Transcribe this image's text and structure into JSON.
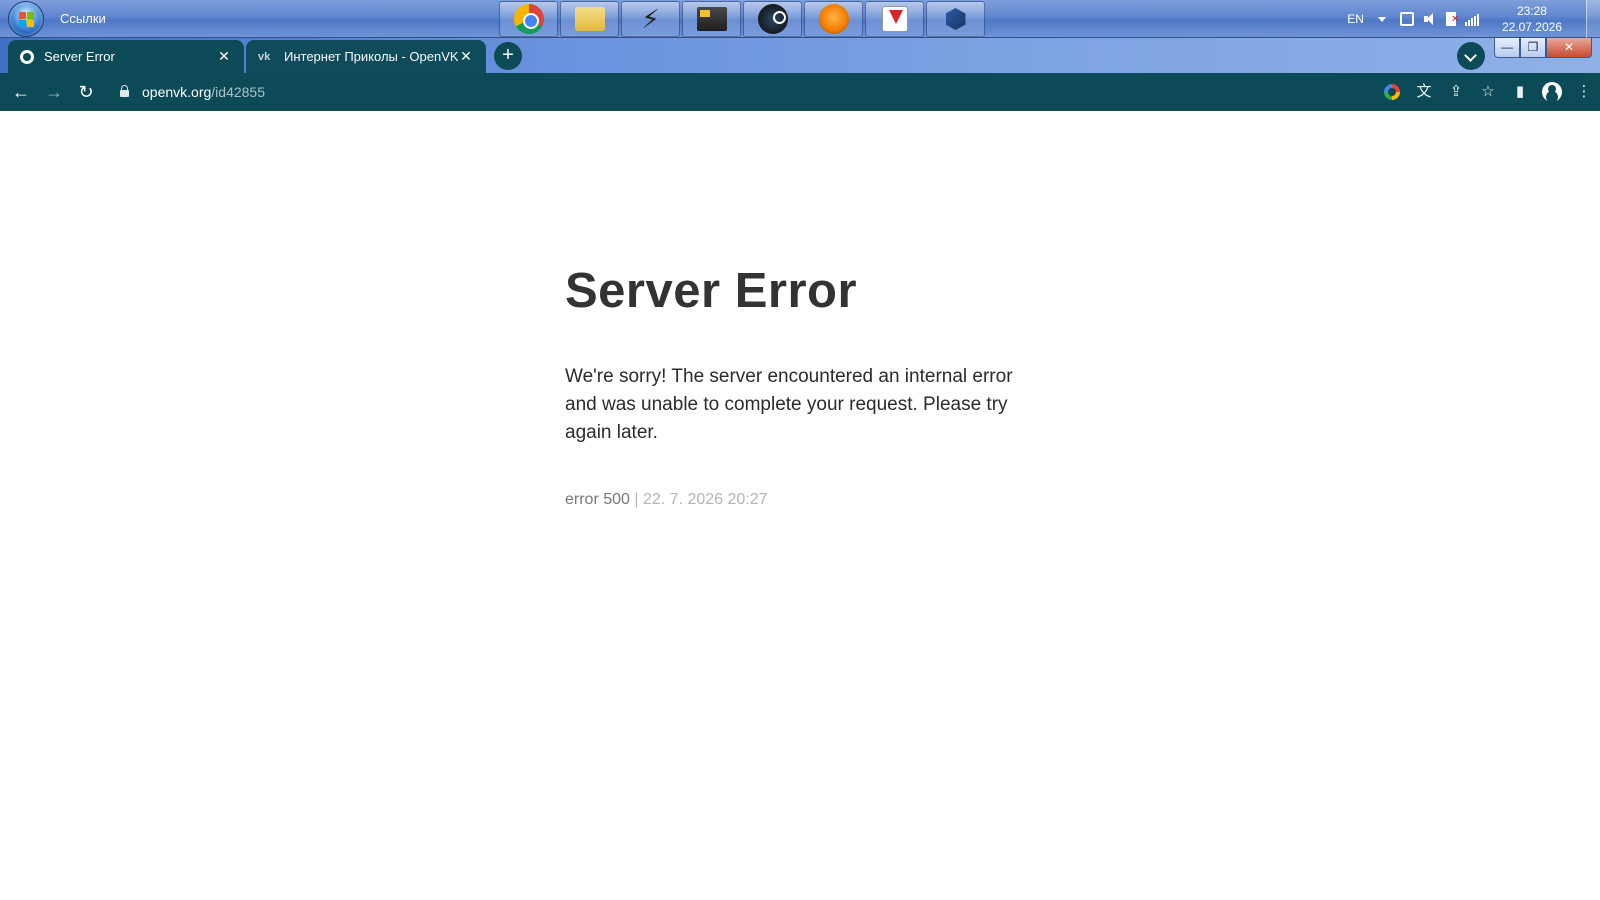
{
  "taskbar": {
    "links_label": "Ссылки",
    "pinned": [
      "chrome-icon",
      "folder-icon",
      "winamp-icon",
      "monitor-icon",
      "steam-icon",
      "fl-studio-icon",
      "download-icon",
      "virtualbox-icon"
    ],
    "tray": {
      "language": "EN",
      "time": "23:28",
      "date": "22.07.2026"
    }
  },
  "browser": {
    "tabs": [
      {
        "title": "Server Error",
        "close": "✕",
        "active": true
      },
      {
        "title": "Интернет Приколы - OpenVK",
        "close": "✕",
        "active": false
      }
    ],
    "new_tab_label": "+",
    "window_controls": {
      "minimize": "—",
      "maximize": "❐",
      "close": "✕"
    },
    "address": {
      "host": "openvk.org",
      "path": "/id42855"
    },
    "nav": {
      "back": "←",
      "forward": "→",
      "reload": "↻"
    },
    "toolbar_icons": {
      "share": "⇪",
      "bookmark": "☆",
      "sidepanel": "▮",
      "menu": "⋮",
      "translate": "文"
    }
  },
  "page": {
    "title": "Server Error",
    "message": "We're sorry! The server encountered an internal error and was unable to complete your request. Please try again later.",
    "error_code": "error 500",
    "separator": "|",
    "timestamp": "22. 7. 2026 20:27"
  },
  "colors": {
    "toolbar": "#0d4a57",
    "title_text": "#333333",
    "meta_text": "#777777",
    "meta_light": "#b5b5b5"
  }
}
